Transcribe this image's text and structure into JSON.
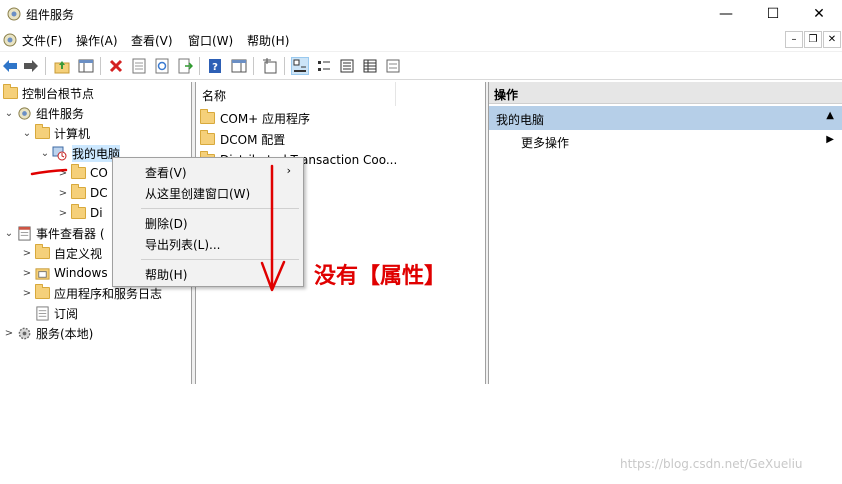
{
  "window": {
    "title": "组件服务",
    "buttons": {
      "minimize": "—",
      "maximize": "☐",
      "close": "✕"
    }
  },
  "menubar": {
    "items": [
      "文件(F)",
      "操作(A)",
      "查看(V)",
      "窗口(W)",
      "帮助(H)"
    ],
    "mdi": {
      "minimize": "–",
      "restore": "❐",
      "close": "✕"
    }
  },
  "toolbar": {
    "icons": [
      "back-arrow-icon",
      "forward-arrow-icon",
      "up-folder-icon",
      "show-hide-console-tree-icon",
      "delete-icon",
      "properties-icon",
      "refresh-icon",
      "export-list-icon",
      "help-icon",
      "show-hide-action-pane-icon",
      "new-window-icon",
      "large-icons-view-icon",
      "small-icons-view-icon",
      "list-view-icon",
      "detail-view-icon",
      "status-view-icon"
    ]
  },
  "tree": {
    "nodes": [
      {
        "label": "控制台根节点",
        "exp": "",
        "icon": "folder"
      },
      {
        "label": "组件服务",
        "exp": "⌄",
        "icon": "gear"
      },
      {
        "label": "计算机",
        "exp": "⌄",
        "icon": "folder"
      },
      {
        "label": "我的电脑",
        "exp": "⌄",
        "icon": "computer"
      },
      {
        "label": "CO",
        "exp": ">",
        "icon": "folder"
      },
      {
        "label": "DC",
        "exp": ">",
        "icon": "folder"
      },
      {
        "label": "Di",
        "exp": ">",
        "icon": "folder"
      },
      {
        "label": "事件查看器 (",
        "exp": "⌄",
        "icon": "eventlog"
      },
      {
        "label": "自定义视",
        "exp": ">",
        "icon": "folder"
      },
      {
        "label": "Windows",
        "exp": ">",
        "icon": "log"
      },
      {
        "label": "应用程序和服务日志",
        "exp": ">",
        "icon": "folder"
      },
      {
        "label": "订阅",
        "exp": "",
        "icon": "log"
      },
      {
        "label": "服务(本地)",
        "exp": ">",
        "icon": "gear"
      }
    ]
  },
  "list": {
    "column": "名称",
    "rows": [
      "COM+ 应用程序",
      "DCOM 配置",
      "Distributed Transaction Coo..."
    ]
  },
  "actions": {
    "header": "操作",
    "section": "我的电脑",
    "item": "更多操作"
  },
  "context_menu": {
    "items": [
      "查看(V)",
      "从这里创建窗口(W)",
      "删除(D)",
      "导出列表(L)...",
      "帮助(H)"
    ]
  },
  "annotation": {
    "text": "没有【属性】",
    "color": "#e00000"
  },
  "watermark": "https://blog.csdn.net/GeXueliu",
  "colors": {
    "selection": "#cce8ff",
    "action_section": "#b6cfe8"
  }
}
